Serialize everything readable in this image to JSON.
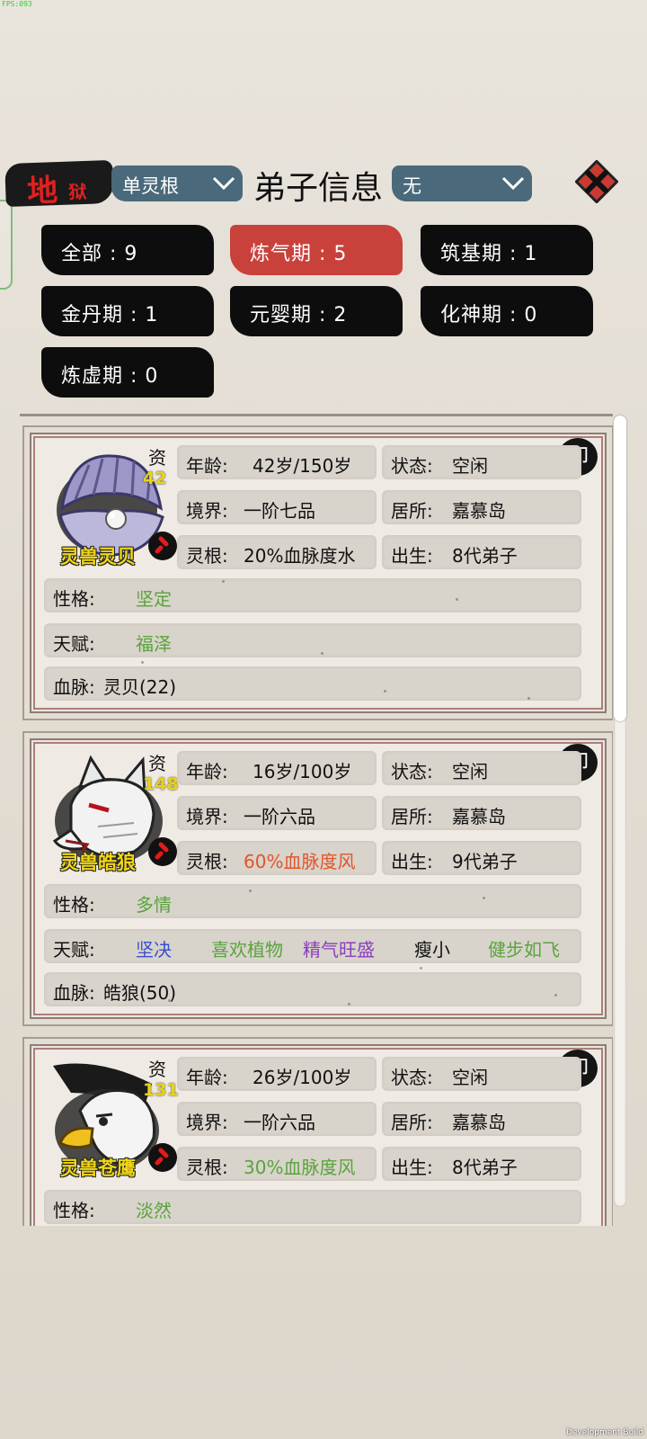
{
  "overlay": {
    "fps": "FPS:093",
    "dev_build": "Development Build"
  },
  "header": {
    "difficulty_big": "地",
    "difficulty_small": "狱",
    "filter_root": "单灵根",
    "title": "弟子信息",
    "filter_other": "无"
  },
  "chips": [
    {
      "label": "全部 : 9"
    },
    {
      "label": "炼气期 : 5",
      "active": true
    },
    {
      "label": "筑基期 : 1"
    },
    {
      "label": "金丹期 : 1"
    },
    {
      "label": "元婴期 : 2"
    },
    {
      "label": "化神期 : 0"
    },
    {
      "label": "炼虚期 : 0"
    }
  ],
  "labels": {
    "zi": "资",
    "age": "年龄:",
    "state": "状态:",
    "realm": "境界:",
    "home": "居所:",
    "root": "灵根:",
    "birth": "出生:",
    "personality": "性格:",
    "talent": "天赋:",
    "blood": "血脉:"
  },
  "cards": [
    {
      "name": "灵兽灵贝",
      "aptitude": "42",
      "portrait_icon": "pearl-clam-icon",
      "age": "42岁/150岁",
      "state": "空闲",
      "realm": "一阶七品",
      "home": "嘉慕岛",
      "root": "20%血脉度水",
      "birth": "8代弟子",
      "personality": "坚定",
      "talents": [
        "福泽"
      ],
      "blood": "灵贝(22)"
    },
    {
      "name": "灵兽皓狼",
      "aptitude": "148",
      "portrait_icon": "white-wolf-icon",
      "age": "16岁/100岁",
      "state": "空闲",
      "realm": "一阶六品",
      "home": "嘉慕岛",
      "root": "60%血脉度风",
      "birth": "9代弟子",
      "personality": "多情",
      "talents": [
        "坚决",
        "喜欢植物",
        "精气旺盛",
        "瘦小",
        "健步如飞"
      ],
      "blood": "皓狼(50)"
    },
    {
      "name": "灵兽苍鹰",
      "aptitude": "131",
      "portrait_icon": "eagle-icon",
      "age": "26岁/100岁",
      "state": "空闲",
      "realm": "一阶六品",
      "home": "嘉慕岛",
      "root": "30%血脉度风",
      "birth": "8代弟子",
      "personality": "淡然"
    }
  ],
  "unlock_glyph": "卸",
  "colors": {
    "root_water": "#111111",
    "root_wind_orange": "#e2552a",
    "root_wind_green": "#5aa43c",
    "personality_green": "#5aa43c",
    "talent_blue": "#3a4fd0",
    "talent_purple": "#8a3ec0",
    "active_chip": "#c9413b"
  }
}
